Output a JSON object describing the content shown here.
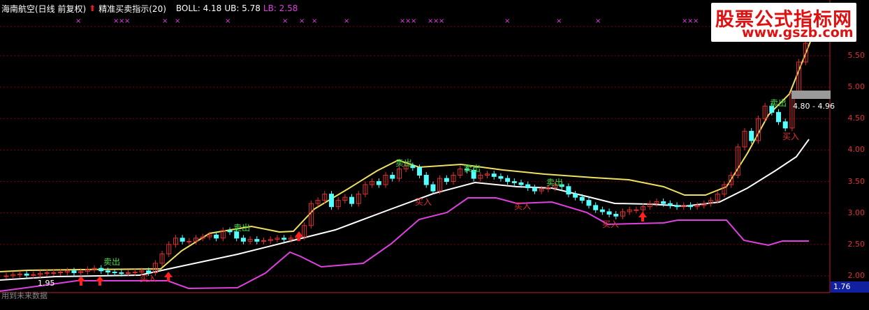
{
  "header": {
    "stock_label": "海南航空(日线 前复权)",
    "indicator_label": "精准买卖指示(20)",
    "boll_label": "BOLL: 4.18",
    "ub_label": "UB: 5.78",
    "lb_label": "LB: 2.58",
    "up_arrow_icon": "red-up-arrow-icon"
  },
  "watermark": {
    "line1": "股票公式指标网",
    "line2": "www.gszb.com"
  },
  "y_axis": {
    "labels": [
      "5.50",
      "5.00",
      "4.50",
      "4.00",
      "3.50",
      "3.00",
      "2.50",
      "2.00"
    ],
    "values": [
      5.5,
      5.0,
      4.5,
      4.0,
      3.5,
      3.0,
      2.5,
      2.0
    ]
  },
  "price_range_text": "4.80 - 4.96",
  "current_price": "1.76",
  "low_label": "1.95",
  "future_note": "用到未来数据",
  "signals": {
    "sell": "卖出",
    "buy": "买入"
  },
  "colors": {
    "background": "#000000",
    "up_candle": "#e03030",
    "down_candle": "#54ffff",
    "upper_band": "#f0e060",
    "mid_band": "#ffffff",
    "lower_band": "#e040e0",
    "sell_text": "#40e040",
    "buy_text": "#e03030",
    "grid": "#800000"
  }
}
